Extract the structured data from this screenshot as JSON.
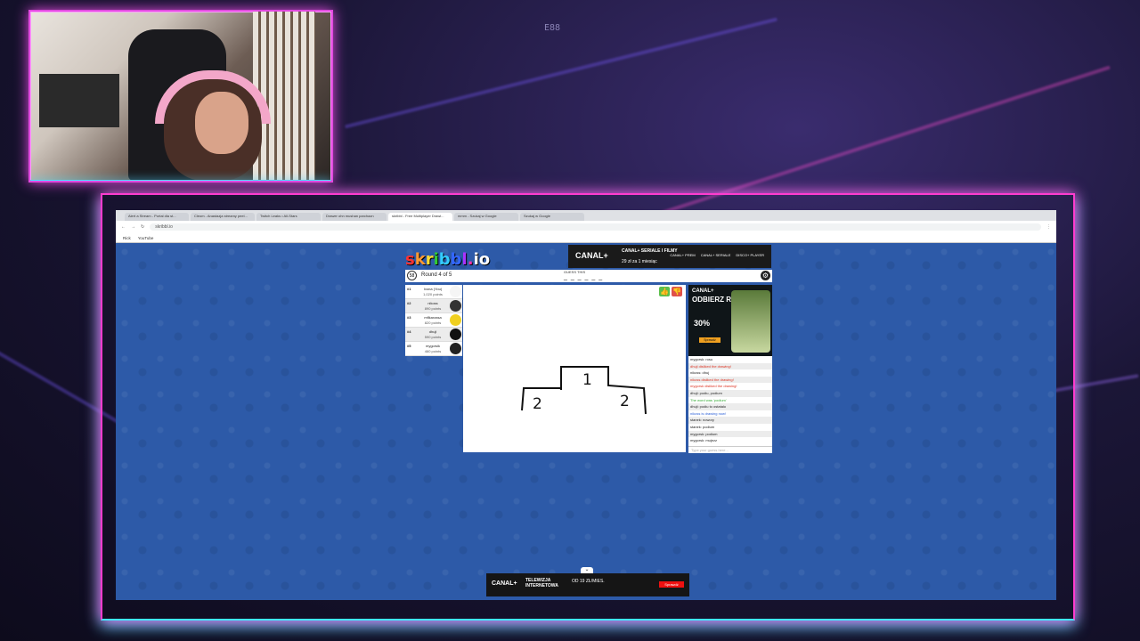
{
  "overlay": {
    "top_center": "E88",
    "accent_pink": "#ff3ccf",
    "accent_cyan": "#3ee8ff"
  },
  "browser": {
    "tabs": [
      "Alert a Stream - Portal dla st...",
      "Cleom - Anastazja streamy peel...",
      "Twitch Leaks • All-Stars",
      "Drawer ohn mushan parchazn",
      "skribbl - Free Multiplayer Drawi...",
      "mmm - Szukaj w Google",
      "Szukaj w Google"
    ],
    "active_tab": 4,
    "url": "skribbl.io",
    "bookmarks": [
      "Rick",
      "YouTube"
    ]
  },
  "game": {
    "logo_letters": [
      "s",
      "k",
      "r",
      "i",
      "b",
      "b",
      "l",
      ".",
      "i",
      "o"
    ],
    "clock": "58",
    "round": "Round 4 of 5",
    "hint_label": "GUESS THIS",
    "word": "_ _ _ _ _ _",
    "players": [
      {
        "rank": "#1",
        "name": "Ivona (You)",
        "points": "1,020 points",
        "avatar": "#f5f5f5"
      },
      {
        "rank": "#2",
        "name": "nikoss",
        "points": "890 points",
        "avatar": "#333"
      },
      {
        "rank": "#3",
        "name": "mflkarzasa",
        "points": "820 points",
        "avatar": "#f0d020"
      },
      {
        "rank": "#4",
        "name": "dhuji",
        "points": "590 points",
        "avatar": "#111"
      },
      {
        "rank": "#5",
        "name": "mygorsik",
        "points": "460 points",
        "avatar": "#222"
      }
    ],
    "drawer_tip": "mygorsk",
    "podium_labels": [
      "1",
      "2",
      "2"
    ],
    "rate_icons": [
      "thumbs-up",
      "thumbs-down"
    ],
    "settings_icon": "gear"
  },
  "chat": {
    "messages": [
      {
        "text": "mygorsk: rosu",
        "kind": "normal"
      },
      {
        "text": "dhuji disliked the drawing!",
        "kind": "like"
      },
      {
        "text": "nikoss: dhuj",
        "kind": "normal"
      },
      {
        "text": "nikoss disliked the drawing!",
        "kind": "like"
      },
      {
        "text": "mygorsk disliked the drawing!",
        "kind": "like"
      },
      {
        "text": "dhuji: podiu, podium",
        "kind": "normal"
      },
      {
        "text": "The word was 'podium'",
        "kind": "guess"
      },
      {
        "text": "dhuji: podiu to ostatalo",
        "kind": "normal"
      },
      {
        "text": "nikoss is drawing now!",
        "kind": "draw"
      },
      {
        "text": "stanek: nowory",
        "kind": "normal"
      },
      {
        "text": "stanek: podium",
        "kind": "normal"
      },
      {
        "text": "mygorsk: podium",
        "kind": "normal"
      },
      {
        "text": "mygorsk: mujezz",
        "kind": "normal"
      }
    ],
    "placeholder": "Type your guess here..."
  },
  "ads": {
    "top": {
      "brand": "CANAL+",
      "line1": "CANAL+ SERIALE I FILMY",
      "line2": "29 zł za 1 miesiąc",
      "chips": [
        "CANAL+ PREM",
        "CANAL+ SERIALE",
        "DISCO+ PLAYER"
      ]
    },
    "side": {
      "brand": "CANAL+",
      "headline": "ODBIERZ RABAT",
      "percent": "30%",
      "cta": "Sprawdź"
    },
    "bottom": {
      "brand": "CANAL+",
      "line1": "TELEWIZJA",
      "line2": "INTERNETOWA",
      "price": "OD 19 ZŁ/MIES.",
      "cta": "Sprawdź"
    }
  }
}
